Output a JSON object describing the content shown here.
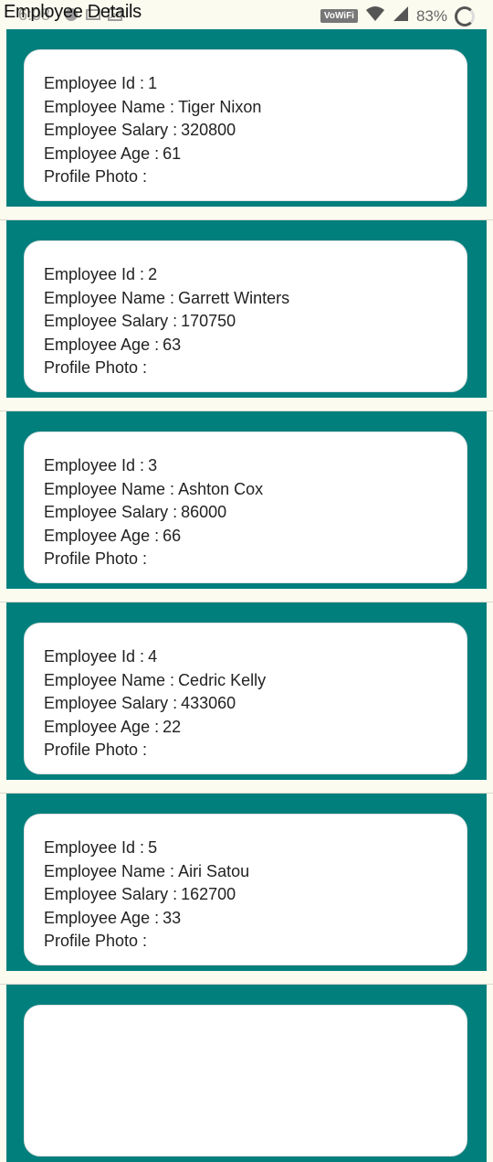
{
  "header": {
    "title": "Employee Details"
  },
  "status_bar": {
    "time": "6:08",
    "network": "VoWiFi",
    "battery": "83%"
  },
  "labels": {
    "id": "Employee Id :",
    "name": "Employee Name :",
    "salary": "Employee Salary :",
    "age": "Employee Age :",
    "photo": "Profile Photo :"
  },
  "employees": [
    {
      "id": "1",
      "name": "Tiger Nixon",
      "salary": "320800",
      "age": "61"
    },
    {
      "id": "2",
      "name": "Garrett Winters",
      "salary": "170750",
      "age": "63"
    },
    {
      "id": "3",
      "name": "Ashton Cox",
      "salary": "86000",
      "age": "66"
    },
    {
      "id": "4",
      "name": "Cedric Kelly",
      "salary": "433060",
      "age": "22"
    },
    {
      "id": "5",
      "name": "Airi Satou",
      "salary": "162700",
      "age": "33"
    }
  ],
  "colors": {
    "card_bg": "#017f7d",
    "page_bg": "#fbfbef"
  }
}
